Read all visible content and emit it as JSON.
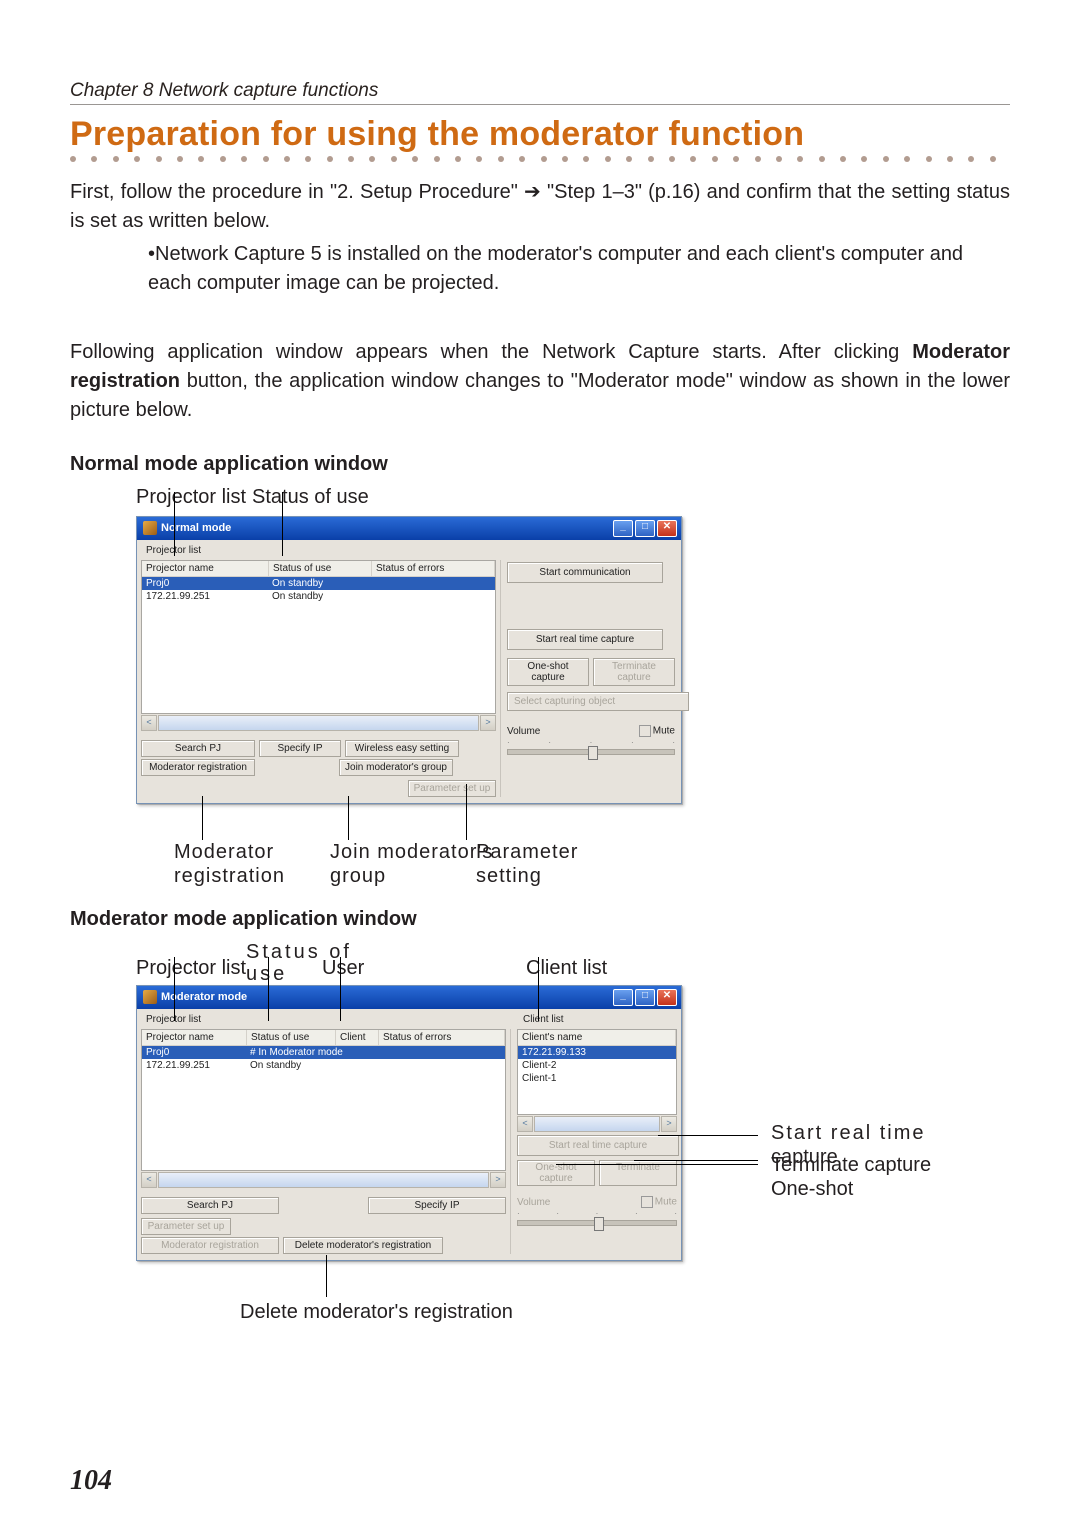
{
  "chapter_header": "Chapter 8 Network capture functions",
  "title": "Preparation for using the moderator function",
  "intro_1a": "First, follow the procedure in \"2. Setup Procedure\" ",
  "intro_arrow": "➔",
  "intro_1b": " \"Step 1–3\" (p.16) and confirm that the setting status is set as written below.",
  "bullet_1": "•Network Capture 5 is installed on the moderator's computer and each client's computer and each  computer image can be projected.",
  "intro_2a": "Following application window appears when the Network Capture starts. After clicking ",
  "intro_2b": "Moderator registration",
  "intro_2c": " button, the application window changes to \"Moderator mode\" window as shown in the lower picture below.",
  "sub_normal": "Normal mode application window",
  "annot": {
    "projector_list": "Projector list",
    "status_of_use": "Status of use",
    "user": "User",
    "client_list": "Client list"
  },
  "normal_window": {
    "title": "Normal mode",
    "group": "Projector list",
    "cols": [
      "Projector name",
      "Status of use",
      "Status of errors"
    ],
    "rows": [
      {
        "name": "Proj0",
        "status": "On standby",
        "err": ""
      },
      {
        "name": "172.21.99.251",
        "status": "On standby",
        "err": ""
      }
    ],
    "right": {
      "start_comm": "Start communication",
      "start_real": "Start real time capture",
      "one_shot": "One-shot capture",
      "terminate": "Terminate capture",
      "select_obj": "Select capturing object",
      "volume": "Volume",
      "mute": "Mute"
    },
    "bottom": {
      "search": "Search PJ",
      "specify": "Specify IP",
      "wireless": "Wireless easy setting",
      "paramset": "Parameter set up",
      "modreg": "Moderator registration",
      "joingrp": "Join moderator's group"
    }
  },
  "callouts_normal": {
    "modreg_1": "Moderator",
    "modreg_2": "registration",
    "join_1": "Join moderator's",
    "join_2": "group",
    "param_1": "Parameter",
    "param_2": "setting"
  },
  "sub_moderator": "Moderator mode application window",
  "moderator_window": {
    "title": "Moderator mode",
    "group": "Projector list",
    "cols": [
      "Projector name",
      "Status of use",
      "Client",
      "Status of errors"
    ],
    "status_small": "Status of use",
    "rows": [
      {
        "name": "Proj0",
        "status": "# In Moderator mode",
        "client": "",
        "err": ""
      },
      {
        "name": "172.21.99.251",
        "status": "On standby",
        "client": "",
        "err": ""
      }
    ],
    "client": {
      "label": "Client list",
      "col": "Client's name",
      "items": [
        "172.21.99.133",
        "Client-2",
        "Client-1"
      ]
    },
    "right": {
      "start_real": "Start real time capture",
      "one_shot": "One-shot capture",
      "terminate": "Terminate",
      "volume": "Volume",
      "mute": "Mute"
    },
    "bottom": {
      "search": "Search PJ",
      "specify": "Specify IP",
      "paramset": "Parameter set up",
      "modreg": "Moderator registration",
      "delreg": "Delete moderator's registration"
    }
  },
  "callouts_moderator": {
    "del_reg": "Delete moderator's registration",
    "start_real_1": "Start real time",
    "start_real_2": "capture",
    "terminate": "Terminate capture",
    "oneshot": "One-shot"
  },
  "page_number": "104"
}
